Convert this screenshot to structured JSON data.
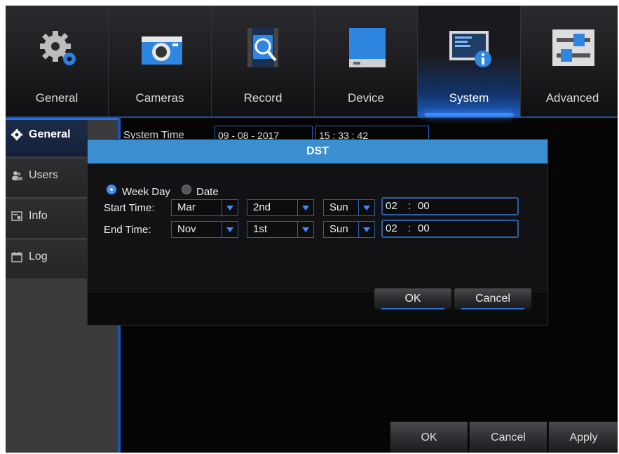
{
  "nav": {
    "tabs": [
      {
        "label": "General",
        "icon": "gears-icon"
      },
      {
        "label": "Cameras",
        "icon": "camera-icon"
      },
      {
        "label": "Record",
        "icon": "record-search-icon"
      },
      {
        "label": "Device",
        "icon": "hard-drive-icon"
      },
      {
        "label": "System",
        "icon": "system-info-icon",
        "active": true
      },
      {
        "label": "Advanced",
        "icon": "sliders-icon"
      }
    ]
  },
  "sidebar": {
    "items": [
      {
        "label": "General",
        "icon": "gear-icon",
        "active": true
      },
      {
        "label": "Users",
        "icon": "users-icon"
      },
      {
        "label": "Info",
        "icon": "info-icon"
      },
      {
        "label": "Log",
        "icon": "calendar-icon"
      }
    ]
  },
  "system_time": {
    "label": "System Time",
    "date": "09 - 08 - 2017",
    "time": "15 : 33 : 42"
  },
  "dst_dialog": {
    "title": "DST",
    "mode_options": [
      "Week Day",
      "Date"
    ],
    "selected_mode": "Week Day",
    "start": {
      "label": "Start Time:",
      "month": "Mar",
      "week": "2nd",
      "day": "Sun",
      "hour": "02",
      "minute": "00"
    },
    "end": {
      "label": "End Time:",
      "month": "Nov",
      "week": "1st",
      "day": "Sun",
      "hour": "02",
      "minute": "00"
    },
    "time_separator": ":",
    "ok_label": "OK",
    "cancel_label": "Cancel"
  },
  "footer": {
    "ok_label": "OK",
    "cancel_label": "Cancel",
    "apply_label": "Apply"
  },
  "colors": {
    "accent": "#3a8cff",
    "dialog_title_bar": "#3a8fd1"
  }
}
